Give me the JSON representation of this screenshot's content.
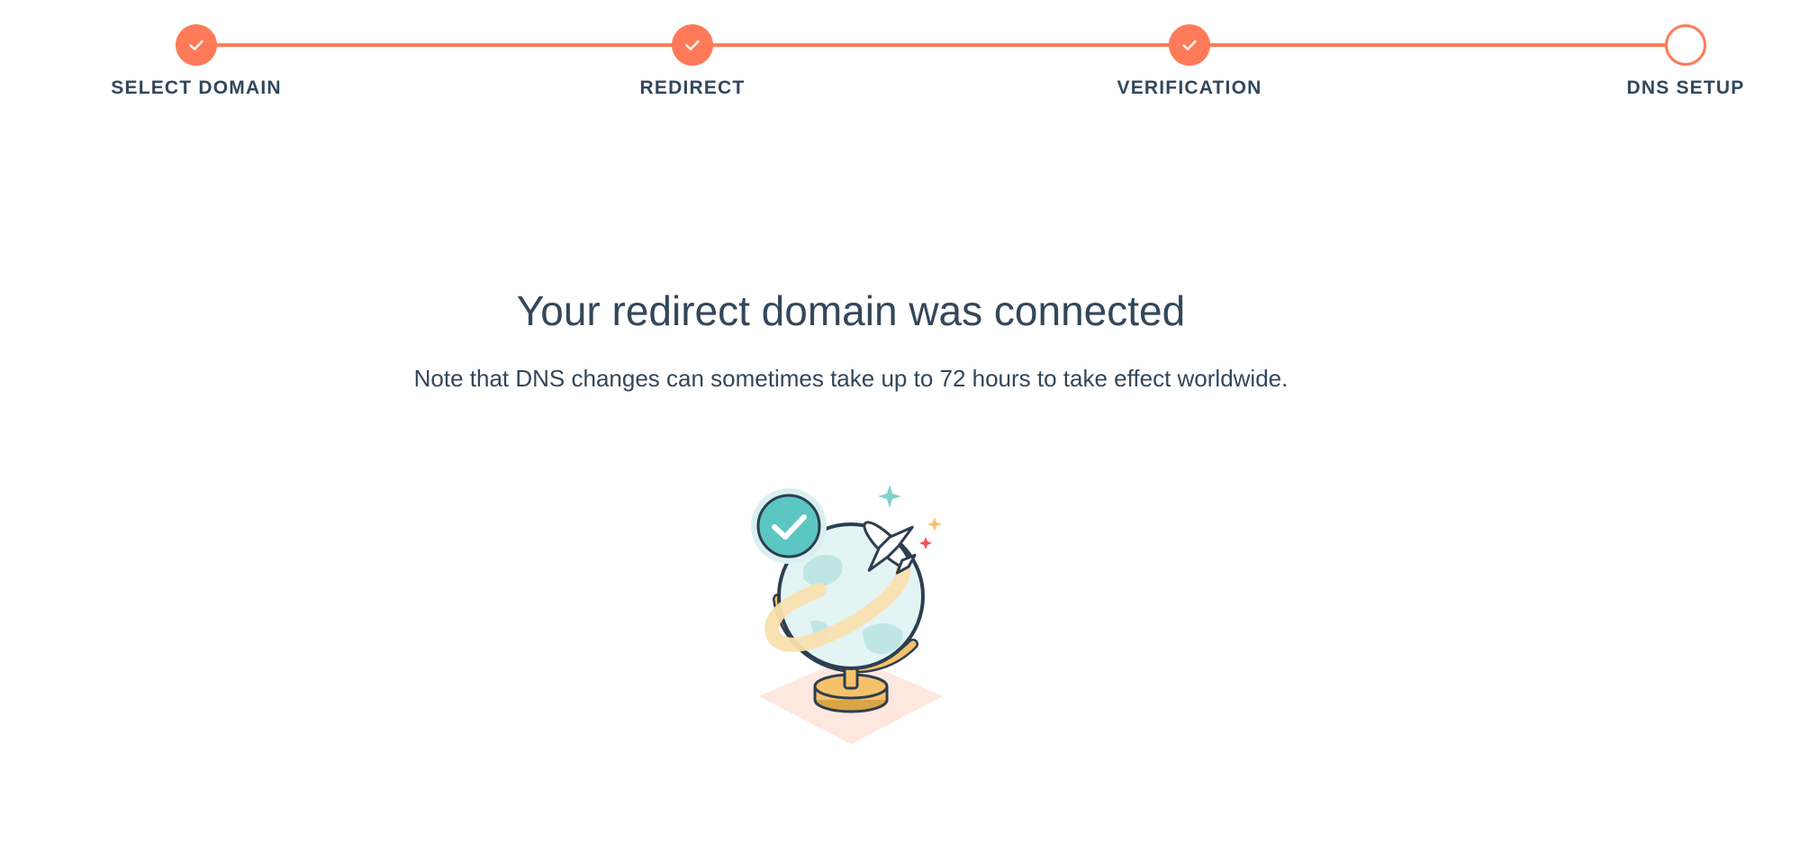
{
  "stepper": {
    "steps": [
      {
        "label": "SELECT DOMAIN",
        "status": "complete"
      },
      {
        "label": "REDIRECT",
        "status": "complete"
      },
      {
        "label": "VERIFICATION",
        "status": "complete"
      },
      {
        "label": "DNS SETUP",
        "status": "current"
      }
    ],
    "accent_color": "#ff7a59"
  },
  "main": {
    "title": "Your redirect domain was connected",
    "note": "Note that DNS changes can sometimes take up to 72 hours to take effect worldwide."
  },
  "illustration": {
    "icon": "globe-airplane-success-illustration"
  }
}
